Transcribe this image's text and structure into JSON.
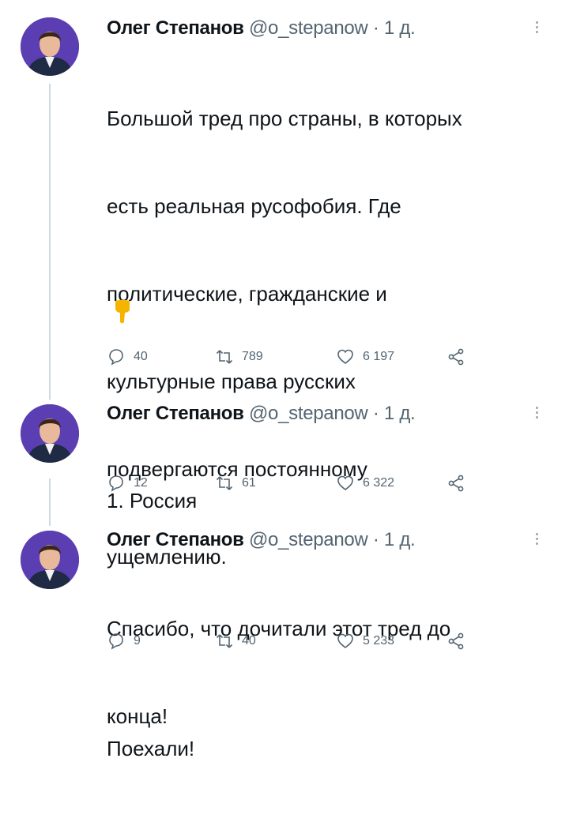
{
  "author": {
    "name": "Олег Степанов",
    "handle": "@o_stepanow",
    "separator": "·",
    "time": "1 д."
  },
  "tweets": [
    {
      "lines": [
        "Большой тред про страны, в которых",
        "есть реальная русофобия. Где",
        "политические, гражданские и",
        "культурные права русских",
        "подвергаются постоянному",
        "ущемлению.",
        "",
        "Поехали!"
      ],
      "emoji": "pointing-down-hand",
      "replies": "40",
      "retweets": "789",
      "likes": "6 197"
    },
    {
      "lines": [
        "1. Россия"
      ],
      "replies": "12",
      "retweets": "61",
      "likes": "6 322"
    },
    {
      "lines": [
        "Спасибо, что дочитали этот тред до",
        "конца!"
      ],
      "replies": "9",
      "retweets": "40",
      "likes": "5 233"
    }
  ],
  "colors": {
    "avatar_bg": "#5b3fb2",
    "text": "#0f1419",
    "secondary": "#536471",
    "thread_line": "#cfd9de",
    "emoji": "#f4b400"
  }
}
